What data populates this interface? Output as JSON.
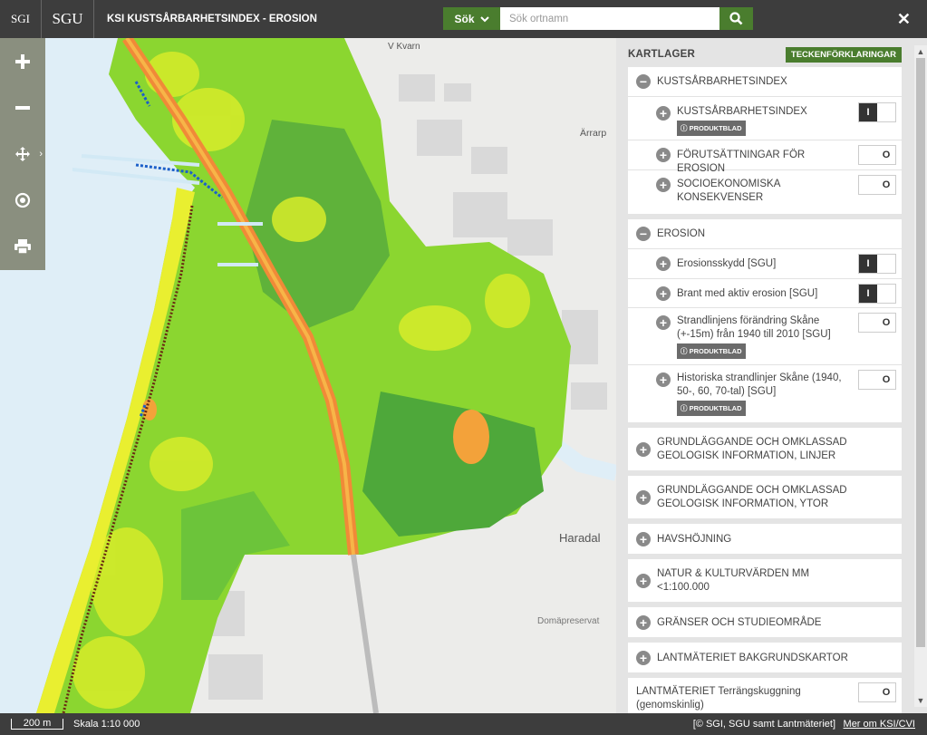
{
  "header": {
    "logo_sgi": "SGI",
    "logo_sgu": "SGU",
    "title": "KSI KUSTSÅRBARHETSINDEX - EROSION",
    "search_mode": "Sök",
    "search_placeholder": "Sök ortnamn"
  },
  "toolbar": {
    "items": [
      "zoom-in",
      "zoom-out",
      "pan",
      "locate",
      "print"
    ]
  },
  "map": {
    "place_labels": [
      "V Kvarn",
      "Ärrarp",
      "Haradal",
      "Domäpreservat"
    ]
  },
  "panel": {
    "title": "KARTLAGER",
    "legend_button": "TECKENFÖRKLARINGAR",
    "groups": [
      {
        "label": "KUSTSÅRBARHETSINDEX",
        "expanded": true,
        "layers": [
          {
            "label": "KUSTSÅRBARHETSINDEX",
            "badge": "PRODUKTBLAD",
            "state": "I"
          },
          {
            "label": "FÖRUTSÄTTNINGAR FÖR EROSION",
            "state": "O"
          },
          {
            "label": "SOCIOEKONOMISKA KONSEKVENSER",
            "state": "O"
          }
        ]
      },
      {
        "label": "EROSION",
        "expanded": true,
        "layers": [
          {
            "label": "Erosionsskydd [SGU]",
            "state": "I"
          },
          {
            "label": "Brant med aktiv erosion [SGU]",
            "state": "I"
          },
          {
            "label": "Strandlinjens förändring Skåne (+-15m) från 1940 till 2010 [SGU]",
            "badge": "PRODUKTBLAD",
            "state": "O"
          },
          {
            "label": "Historiska strandlinjer Skåne (1940, 50-, 60, 70-tal) [SGU]",
            "badge": "PRODUKTBLAD",
            "state": "O"
          }
        ]
      },
      {
        "label": "GRUNDLÄGGANDE OCH OMKLASSAD GEOLOGISK INFORMATION, LINJER"
      },
      {
        "label": "GRUNDLÄGGANDE OCH OMKLASSAD GEOLOGISK INFORMATION, YTOR"
      },
      {
        "label": "HAVSHÖJNING"
      },
      {
        "label": "NATUR & KULTURVÄRDEN MM <1:100.000"
      },
      {
        "label": "GRÄNSER OCH STUDIEOMRÅDE"
      },
      {
        "label": "LANTMÄTERIET BAKGRUNDSKARTOR"
      }
    ],
    "extra_layer": {
      "label": "LANTMÄTERIET Terrängskuggning (genomskinlig)",
      "state": "O"
    }
  },
  "footer": {
    "scale_bar": "200 m",
    "scale_text": "Skala 1:10 000",
    "copyright": "[© SGI, SGU samt Lantmäteriet]",
    "more_link": "Mer om KSI/CVI"
  },
  "colors": {
    "header_bg": "#3d3d3d",
    "accent_green": "#4a7d2e",
    "toolbar_bg": "#8a8f7f",
    "sea": "#dfeef7"
  }
}
